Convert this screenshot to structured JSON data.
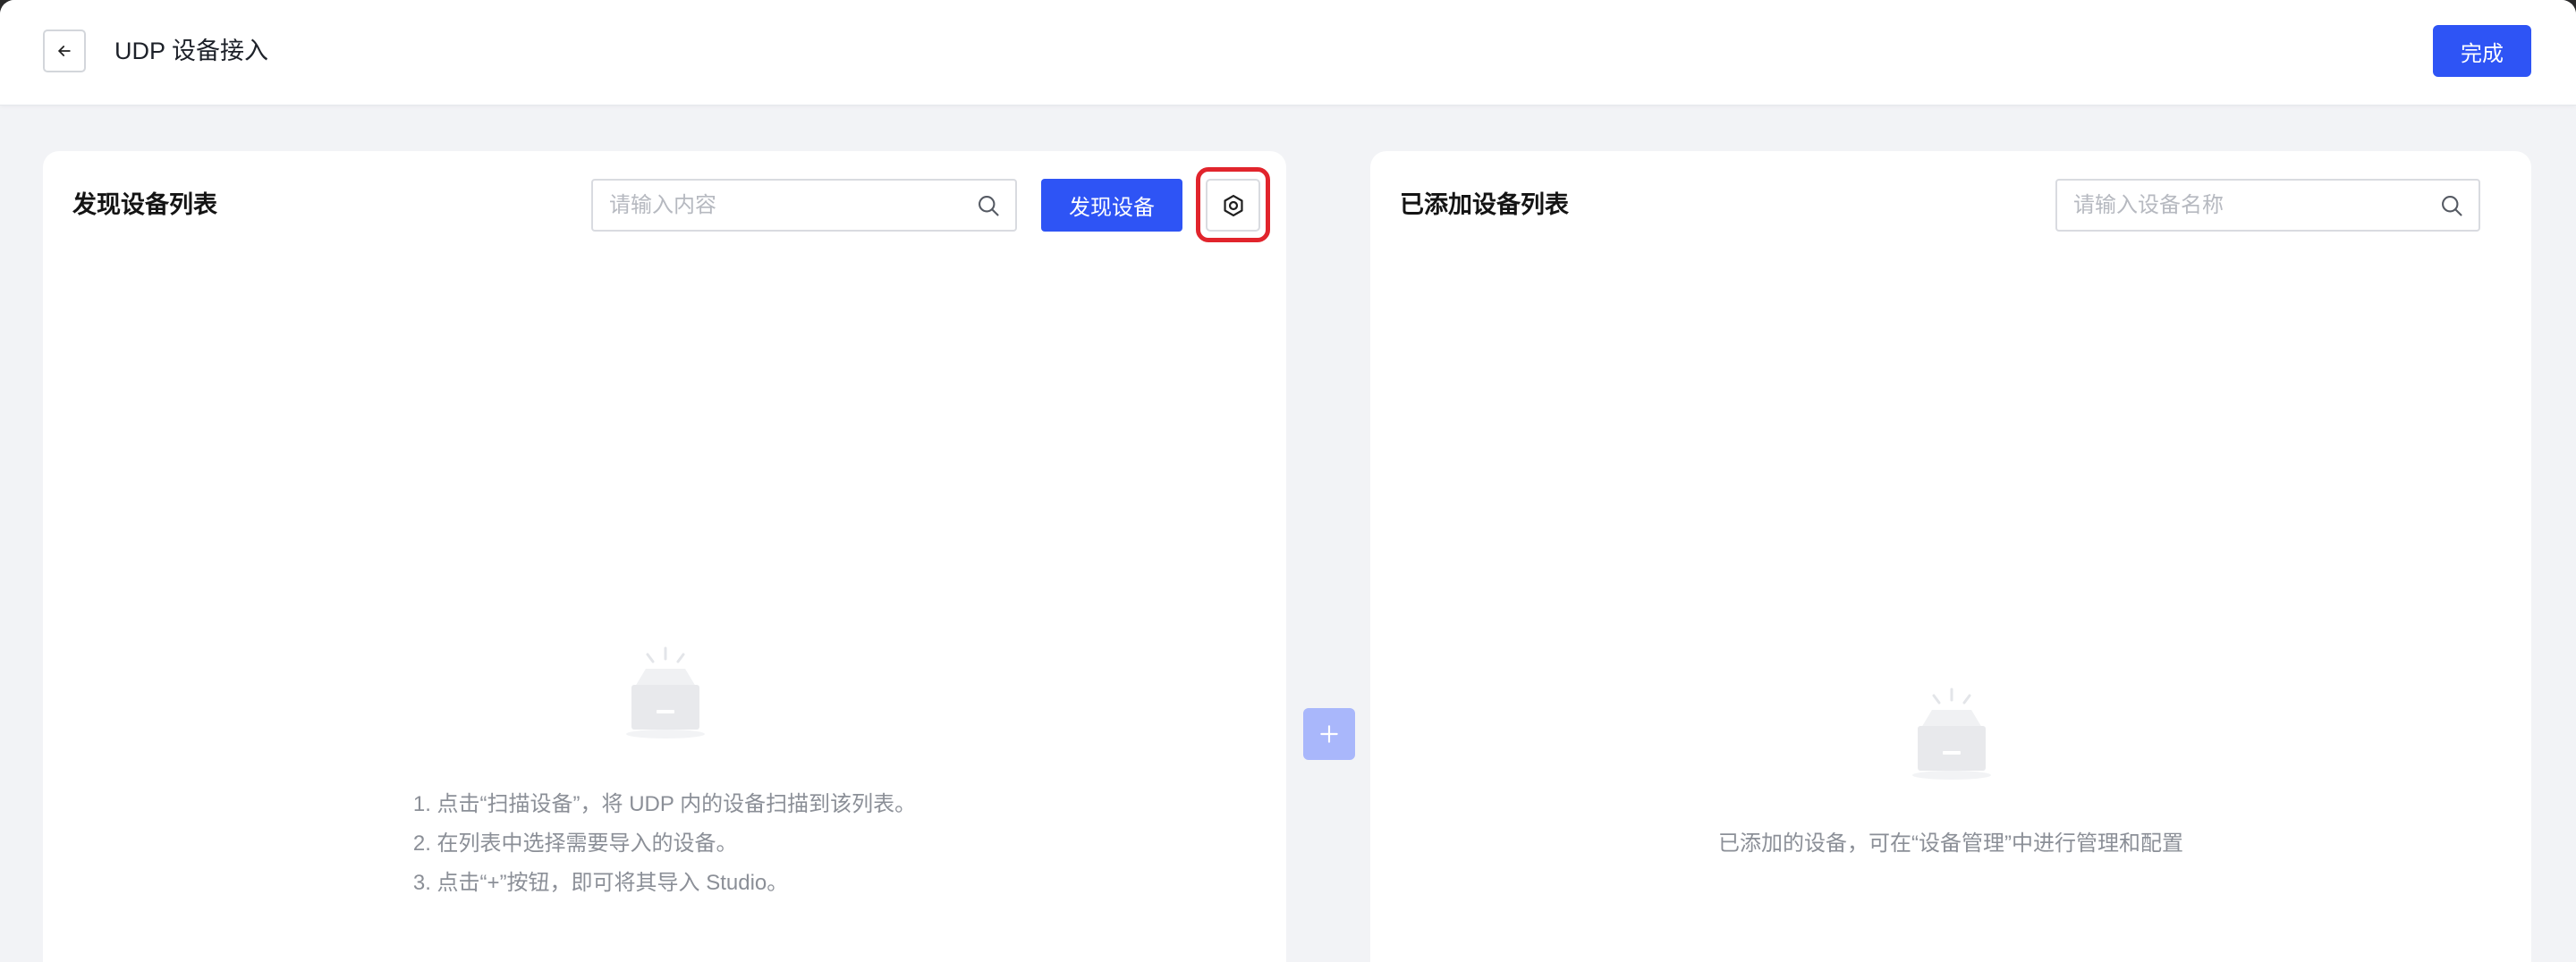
{
  "header": {
    "title": "UDP 设备接入",
    "done_label": "完成",
    "back_icon": "arrow-left-icon"
  },
  "discover_panel": {
    "title": "发现设备列表",
    "search_placeholder": "请输入内容",
    "search_icon": "search-icon",
    "discover_button": "发现设备",
    "settings_icon": "settings-hexagon-icon",
    "empty_icon": "empty-box-icon",
    "empty_steps": [
      "1. 点击“扫描设备”，将 UDP 内的设备扫描到该列表。",
      "2. 在列表中选择需要导入的设备。",
      "3. 点击“+”按钮，即可将其导入 Studio。"
    ]
  },
  "transfer": {
    "add_icon": "plus-icon"
  },
  "added_panel": {
    "title": "已添加设备列表",
    "search_placeholder": "请输入设备名称",
    "search_icon": "search-icon",
    "empty_icon": "empty-box-icon",
    "empty_text": "已添加的设备，可在“设备管理”中进行管理和配置"
  },
  "colors": {
    "primary": "#2e54f5",
    "primary_disabled": "#a9b7fb",
    "highlight": "#e1242c",
    "page_bg": "#f2f3f6"
  }
}
